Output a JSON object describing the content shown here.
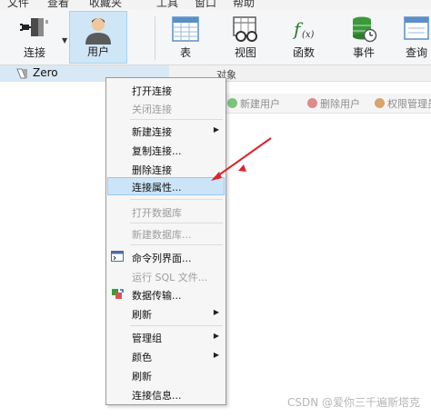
{
  "menubar": {
    "items": [
      "文件",
      "查看",
      "收藏夹",
      "工具",
      "窗口",
      "帮助"
    ]
  },
  "toolbar": {
    "connect": "连接",
    "user": "用户",
    "table": "表",
    "view": "视图",
    "function": "函数",
    "event": "事件",
    "query": "查询"
  },
  "left_panel": {
    "connection_name": "Zero"
  },
  "object_tab": {
    "label": "对象"
  },
  "subtoolbar": {
    "new_user": "新建用户",
    "delete_user": "删除用户",
    "privilege_manager": "权限管理员"
  },
  "context_menu": {
    "items": [
      {
        "label": "打开连接"
      },
      {
        "label": "关闭连接"
      },
      {
        "label": "新建连接"
      },
      {
        "label": "复制连接..."
      },
      {
        "label": "删除连接"
      },
      {
        "label": "连接属性..."
      },
      {
        "label": "打开数据库"
      },
      {
        "label": "新建数据库..."
      },
      {
        "label": "命令列界面..."
      },
      {
        "label": "运行 SQL 文件..."
      },
      {
        "label": "数据传输..."
      },
      {
        "label": "刷新"
      },
      {
        "label": "管理组"
      },
      {
        "label": "颜色"
      },
      {
        "label": "刷新"
      },
      {
        "label": "连接信息..."
      }
    ]
  },
  "watermark": "CSDN @爱你三千遍斯塔克",
  "colors": {
    "highlight": "#cce4f7",
    "arrow": "#d9262b",
    "active_tool": "#cfe6f7"
  }
}
